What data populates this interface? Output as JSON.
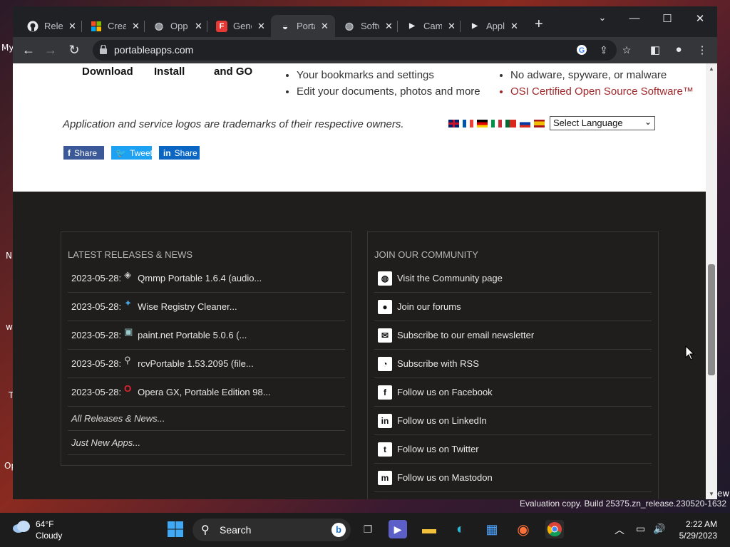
{
  "desktop": {
    "fragments": [
      "My",
      "N",
      "w",
      "T",
      "Op",
      "ew"
    ]
  },
  "tabs": [
    {
      "title": "Rele",
      "icon": "github-icon"
    },
    {
      "title": "Crea",
      "icon": "microsoft-icon"
    },
    {
      "title": "Opp",
      "icon": "globe-icon"
    },
    {
      "title": "Gene",
      "icon": "f-logo-icon"
    },
    {
      "title": "Porta",
      "icon": "portableapps-icon",
      "active": true
    },
    {
      "title": "Softv",
      "icon": "globe-icon"
    },
    {
      "title": "Cam",
      "icon": "play-icon"
    },
    {
      "title": "Appl",
      "icon": "play-icon"
    }
  ],
  "toolbar": {
    "url": "portableapps.com"
  },
  "page": {
    "steps": [
      "Download",
      "Install",
      "and GO"
    ],
    "features_left": [
      "Your bookmarks and settings",
      "Edit your documents, photos and more"
    ],
    "features_right": [
      "No adware, spyware, or malware",
      "OSI Certified Open Source Software™"
    ],
    "trademark": "Application and service logos are trademarks of their respective owners.",
    "language_select": "Select Language",
    "share": {
      "facebook": "Share",
      "twitter": "Tweet",
      "linkedin": "Share"
    },
    "colors": {
      "facebook": "#3b5998",
      "twitter": "#1da1f2",
      "linkedin": "#0a66c2",
      "footer_bg": "#201e1d",
      "osi_link": "#a0282a"
    }
  },
  "news": {
    "heading": "LATEST RELEASES & NEWS",
    "items": [
      {
        "date": "2023-05-28:",
        "title": "Qmmp Portable 1.6.4 (audio..."
      },
      {
        "date": "2023-05-28:",
        "title": "Wise Registry Cleaner..."
      },
      {
        "date": "2023-05-28:",
        "title": "paint.net Portable 5.0.6 (..."
      },
      {
        "date": "2023-05-28:",
        "title": "rcvPortable 1.53.2095 (file..."
      },
      {
        "date": "2023-05-28:",
        "title": "Opera GX, Portable Edition 98..."
      }
    ],
    "links": [
      "All Releases & News...",
      "Just New Apps..."
    ]
  },
  "community": {
    "heading": "JOIN OUR COMMUNITY",
    "items": [
      {
        "label": "Visit the Community page",
        "icon": "globe-icon"
      },
      {
        "label": "Join our forums",
        "icon": "chat-bubble-icon"
      },
      {
        "label": "Subscribe to our email newsletter",
        "icon": "envelope-icon"
      },
      {
        "label": "Subscribe with RSS",
        "icon": "rss-icon"
      },
      {
        "label": "Follow us on Facebook",
        "icon": "facebook-icon"
      },
      {
        "label": "Follow us on LinkedIn",
        "icon": "linkedin-icon"
      },
      {
        "label": "Follow us on Twitter",
        "icon": "twitter-icon"
      },
      {
        "label": "Follow us on Mastodon",
        "icon": "mastodon-icon"
      }
    ]
  },
  "watermark": "Evaluation copy. Build 25375.zn_release.230520-1632",
  "taskbar": {
    "weather_temp": "64°F",
    "weather_cond": "Cloudy",
    "search": "Search",
    "time": "2:22 AM",
    "date": "5/29/2023"
  }
}
